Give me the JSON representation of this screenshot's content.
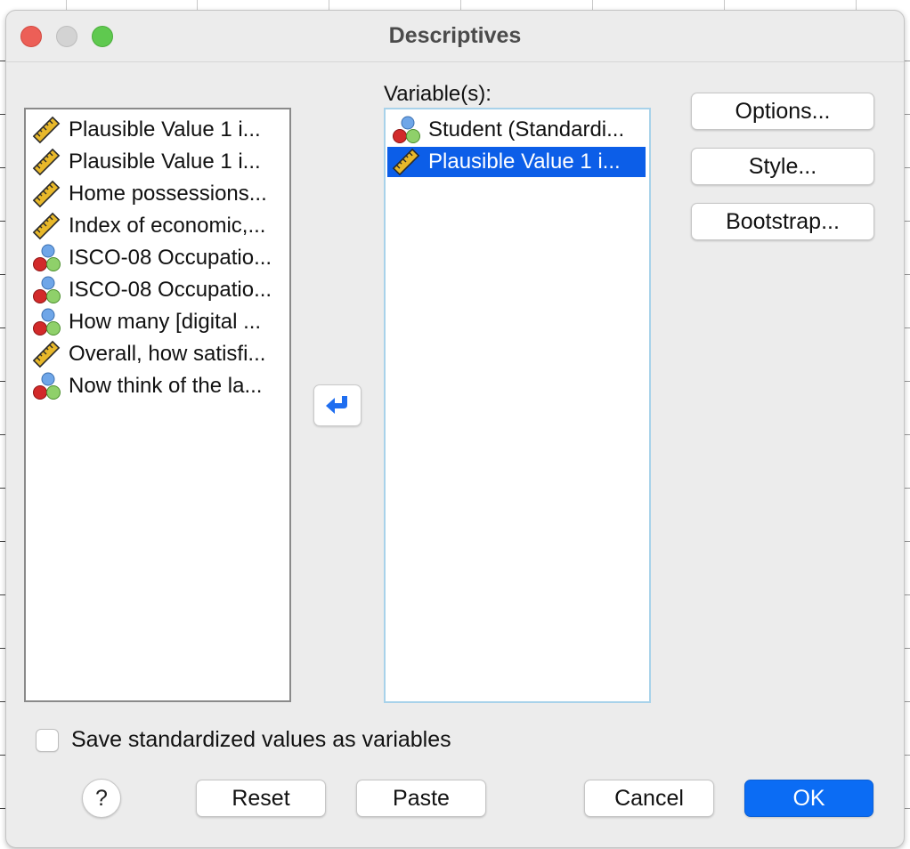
{
  "dialog": {
    "title": "Descriptives"
  },
  "source_list": {
    "items": [
      {
        "label": "Plausible Value 1 i...",
        "icon": "scale-ruler-icon"
      },
      {
        "label": "Plausible Value 1 i...",
        "icon": "scale-ruler-icon"
      },
      {
        "label": "Home possessions...",
        "icon": "scale-ruler-icon"
      },
      {
        "label": "Index of economic,...",
        "icon": "scale-ruler-icon"
      },
      {
        "label": "ISCO-08 Occupatio...",
        "icon": "nominal-balls-icon"
      },
      {
        "label": "ISCO-08 Occupatio...",
        "icon": "nominal-balls-icon"
      },
      {
        "label": "How many [digital ...",
        "icon": "nominal-balls-icon"
      },
      {
        "label": "Overall, how satisfi...",
        "icon": "scale-ruler-icon"
      },
      {
        "label": "Now think of the la...",
        "icon": "nominal-balls-icon"
      }
    ]
  },
  "target": {
    "label": "Variable(s):",
    "items": [
      {
        "label": "Student (Standardi...",
        "icon": "nominal-balls-icon",
        "selected": false
      },
      {
        "label": "Plausible Value 1 i...",
        "icon": "scale-ruler-icon",
        "selected": true
      }
    ]
  },
  "side_buttons": {
    "options": "Options...",
    "style": "Style...",
    "bootstrap": "Bootstrap..."
  },
  "save_checkbox": {
    "label": "Save standardized values as variables",
    "checked": false
  },
  "footer": {
    "help": "?",
    "reset": "Reset",
    "paste": "Paste",
    "cancel": "Cancel",
    "ok": "OK"
  },
  "colors": {
    "selection": "#0c5ee8",
    "ok_button": "#0b6cf4",
    "target_border": "#a8d2ea"
  }
}
